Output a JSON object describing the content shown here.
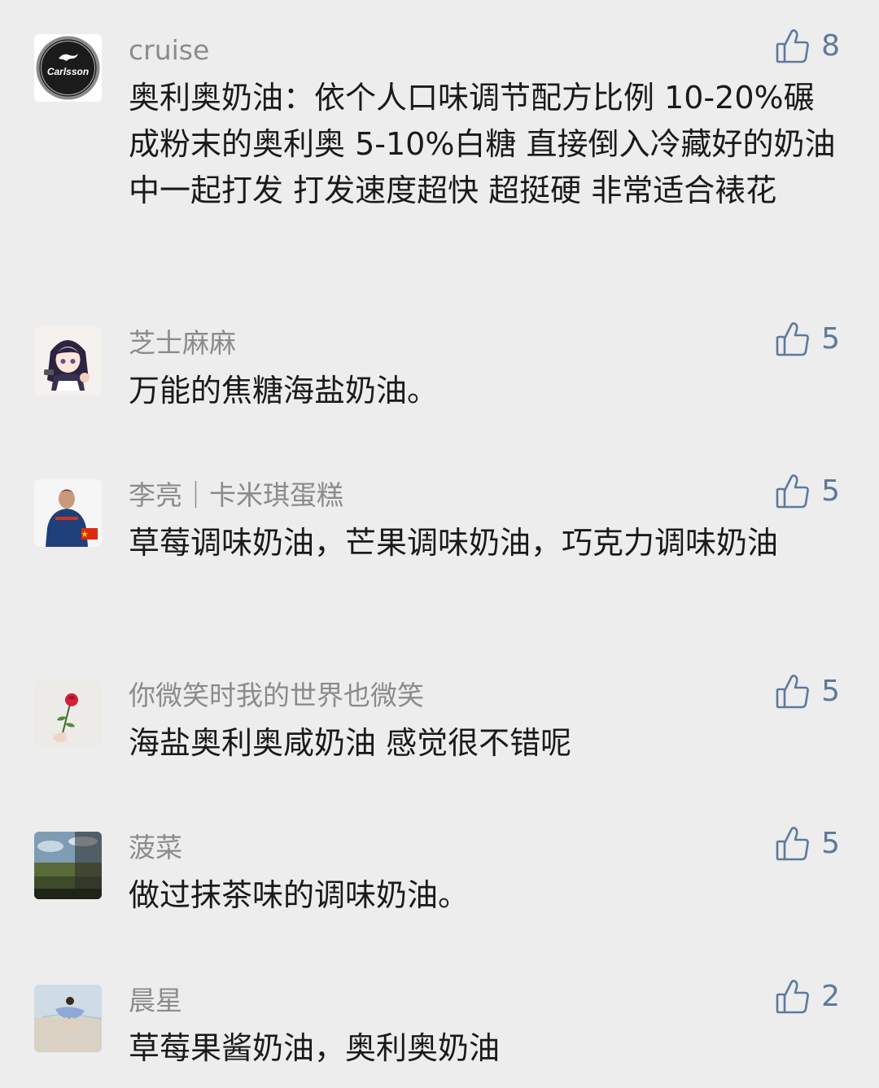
{
  "comments": [
    {
      "nickname": "cruise",
      "avatar_icon": "carlsson-logo-avatar",
      "avatar_text": "Carlsson",
      "like_icon": "thumbs-up-icon",
      "likes": "8",
      "content": "奥利奥奶油：依个人口味调节配方比例 10-20%碾成粉末的奥利奥 5-10%白糖 直接倒入冷藏好的奶油中一起打发 打发速度超快 超挺硬 非常适合裱花"
    },
    {
      "nickname": "芝士麻麻",
      "avatar_icon": "anime-girl-avatar",
      "like_icon": "thumbs-up-icon",
      "likes": "5",
      "content": "万能的焦糖海盐奶油。"
    },
    {
      "nickname": "李亮｜卡米琪蛋糕",
      "avatar_icon": "man-with-flag-avatar",
      "like_icon": "thumbs-up-icon",
      "likes": "5",
      "content": "草莓调味奶油，芒果调味奶油，巧克力调味奶油"
    },
    {
      "nickname": "你微笑时我的世界也微笑",
      "avatar_icon": "rose-in-hand-avatar",
      "like_icon": "thumbs-up-icon",
      "likes": "5",
      "content": "海盐奥利奥咸奶油 感觉很不错呢"
    },
    {
      "nickname": "菠菜",
      "avatar_icon": "landscape-photo-avatar",
      "like_icon": "thumbs-up-icon",
      "likes": "5",
      "content": "做过抹茶味的调味奶油。"
    },
    {
      "nickname": "晨星",
      "avatar_icon": "beach-girl-avatar",
      "like_icon": "thumbs-up-icon",
      "likes": "2",
      "content": "草莓果酱奶油，奥利奥奶油"
    }
  ],
  "colors": {
    "background": "#ededed",
    "nickname": "#8b8b8b",
    "content": "#1a1a1a",
    "like_accent": "#5e7a9c"
  }
}
